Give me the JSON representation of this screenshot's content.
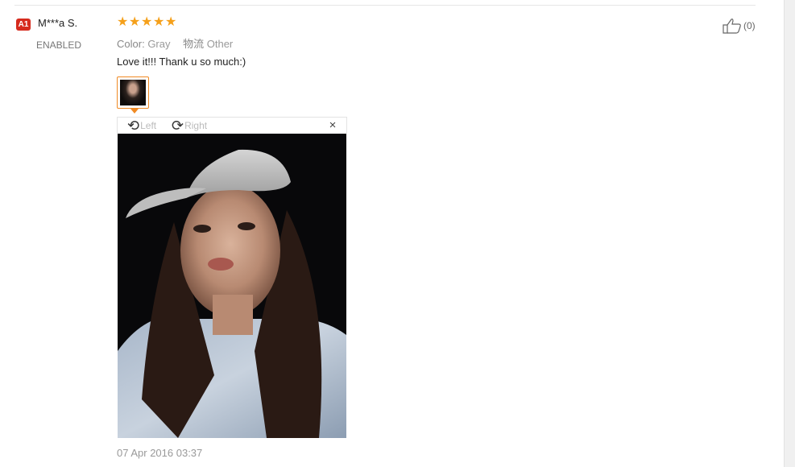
{
  "reviewer": {
    "badge": "A1",
    "name": "M***a S.",
    "status": "ENABLED"
  },
  "rating": {
    "stars": 5,
    "max": 5,
    "star_glyph": "★",
    "color": "#f5a01a"
  },
  "attributes": [
    {
      "key": "Color:",
      "value": "Gray"
    },
    {
      "key": "物流",
      "value": "Other"
    }
  ],
  "review": {
    "text": "Love it!!! Thank u so much:)",
    "date": "07 Apr 2016 03:37"
  },
  "viewer": {
    "rotate_left_label": "Left",
    "rotate_right_label": "Right",
    "close_glyph": "×",
    "icon_left": "rotate-left-icon",
    "icon_right": "rotate-right-icon"
  },
  "helpful": {
    "count": "(0)",
    "icon": "thumbs-up-icon"
  },
  "colors": {
    "accent": "#f08a24",
    "badge": "#d62b1e"
  }
}
